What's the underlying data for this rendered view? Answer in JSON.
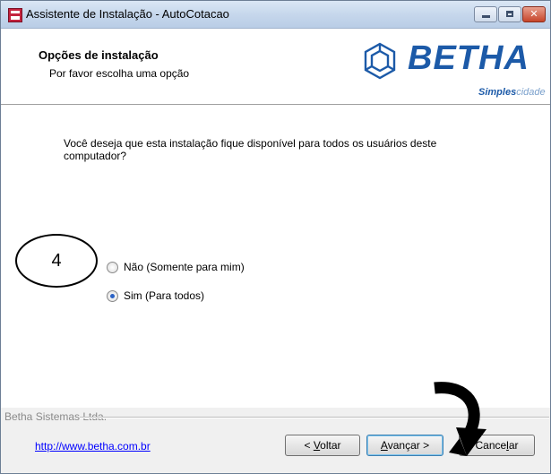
{
  "window": {
    "title": "Assistente de Instalação - AutoCotacao"
  },
  "header": {
    "title": "Opções de instalação",
    "subtitle": "Por favor escolha uma opção",
    "logo_text": "BETHA",
    "logo_tag_bold": "Simples",
    "logo_tag_light": "cidade"
  },
  "content": {
    "question": "Você deseja que esta instalação fique disponível para todos os usuários deste computador?",
    "options": [
      {
        "label": "Não (Somente para mim)",
        "selected": false
      },
      {
        "label": "Sim (Para todos)",
        "selected": true
      }
    ],
    "annotation_number": "4"
  },
  "footer": {
    "company": "Betha Sistemas Ltda.",
    "link": "http://www.betha.com.br",
    "back_prefix": "< ",
    "back_key": "V",
    "back_rest": "oltar",
    "next_key": "A",
    "next_rest": "vançar >",
    "cancel_pre": "Cance",
    "cancel_key": "l",
    "cancel_rest": "ar"
  },
  "colors": {
    "brand": "#1c5aa8",
    "link": "#0000ff"
  }
}
